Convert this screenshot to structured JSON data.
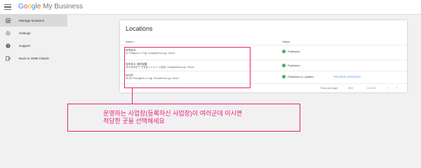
{
  "header": {
    "logo_letters": [
      "G",
      "o",
      "o",
      "g",
      "l",
      "e"
    ],
    "app_name": "My Business"
  },
  "sidebar": {
    "items": [
      {
        "label": "Manage locations",
        "icon": "storefront-icon",
        "active": true
      },
      {
        "label": "Settings",
        "icon": "gear-icon",
        "active": false
      },
      {
        "label": "Support",
        "icon": "help-icon",
        "active": false
      },
      {
        "label": "Back to GMB Classic",
        "icon": "exit-icon",
        "active": false
      }
    ]
  },
  "card": {
    "title": "Locations",
    "columns": {
      "name": "Name ↑",
      "status": "Status"
    },
    "rows": [
      {
        "name": "타미유스",
        "address": "A1 Shilgok-ro 17gil, Dongdaemun-gu, Seoul",
        "status": "Published"
      },
      {
        "name": "타미유스 헤어살롱",
        "address": "국내 동대문구 신설동 1-1 나-1, 신설동, Dongdaemun-gu, Seoul",
        "status": "Published"
      },
      {
        "name": "타디트",
        "address": "28-26 Shongshin-ro 1gil, Seodaemun-gu, Seoul",
        "status": "Published (1 update)",
        "action": "REVIEW UPDATES"
      }
    ],
    "footer": {
      "rows_per_page_label": "Rows per page:",
      "rows_per_page_value": "25",
      "range": "1-3 of 3"
    }
  },
  "annotation": {
    "line1": "운영하는 사업장(등록하신 사업장)이 여러군데 이시면",
    "line2": "적당한 곳을 선택해세요",
    "color": "#e8217a"
  }
}
